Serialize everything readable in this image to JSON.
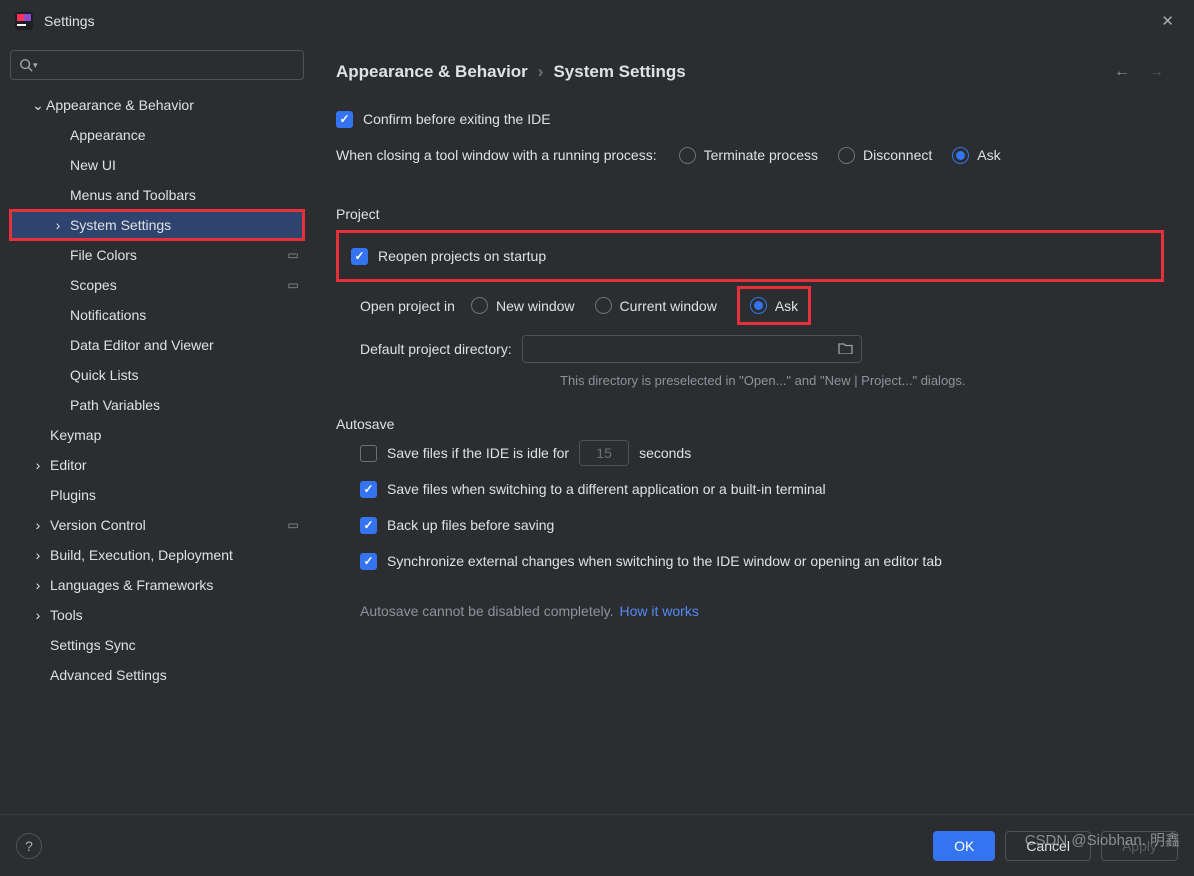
{
  "title": "Settings",
  "breadcrumb": {
    "parent": "Appearance & Behavior",
    "current": "System Settings"
  },
  "sidebar": {
    "appearance_behavior": "Appearance & Behavior",
    "items": {
      "appearance": "Appearance",
      "new_ui": "New UI",
      "menus_toolbars": "Menus and Toolbars",
      "system_settings": "System Settings",
      "file_colors": "File Colors",
      "scopes": "Scopes",
      "notifications": "Notifications",
      "data_editor_viewer": "Data Editor and Viewer",
      "quick_lists": "Quick Lists",
      "path_variables": "Path Variables"
    },
    "keymap": "Keymap",
    "editor": "Editor",
    "plugins": "Plugins",
    "version_control": "Version Control",
    "build": "Build, Execution, Deployment",
    "languages": "Languages & Frameworks",
    "tools": "Tools",
    "settings_sync": "Settings Sync",
    "advanced": "Advanced Settings"
  },
  "main": {
    "confirm_exit": "Confirm before exiting the IDE",
    "closing_label": "When closing a tool window with a running process:",
    "closing_options": {
      "terminate": "Terminate process",
      "disconnect": "Disconnect",
      "ask": "Ask"
    },
    "project_header": "Project",
    "reopen": "Reopen projects on startup",
    "open_in_label": "Open project in",
    "open_in_options": {
      "new_window": "New window",
      "current_window": "Current window",
      "ask": "Ask"
    },
    "default_dir_label": "Default project directory:",
    "default_dir_hint": "This directory is preselected in \"Open...\" and \"New | Project...\" dialogs.",
    "autosave_header": "Autosave",
    "save_idle": "Save files if the IDE is idle for",
    "idle_seconds": "15",
    "seconds_label": "seconds",
    "save_switch": "Save files when switching to a different application or a built-in terminal",
    "backup": "Back up files before saving",
    "sync_external": "Synchronize external changes when switching to the IDE window or opening an editor tab",
    "autosave_note": "Autosave cannot be disabled completely.",
    "how_it_works": "How it works"
  },
  "footer": {
    "ok": "OK",
    "cancel": "Cancel",
    "apply": "Apply"
  },
  "watermark": "CSDN @Siobhan. 明鑫"
}
